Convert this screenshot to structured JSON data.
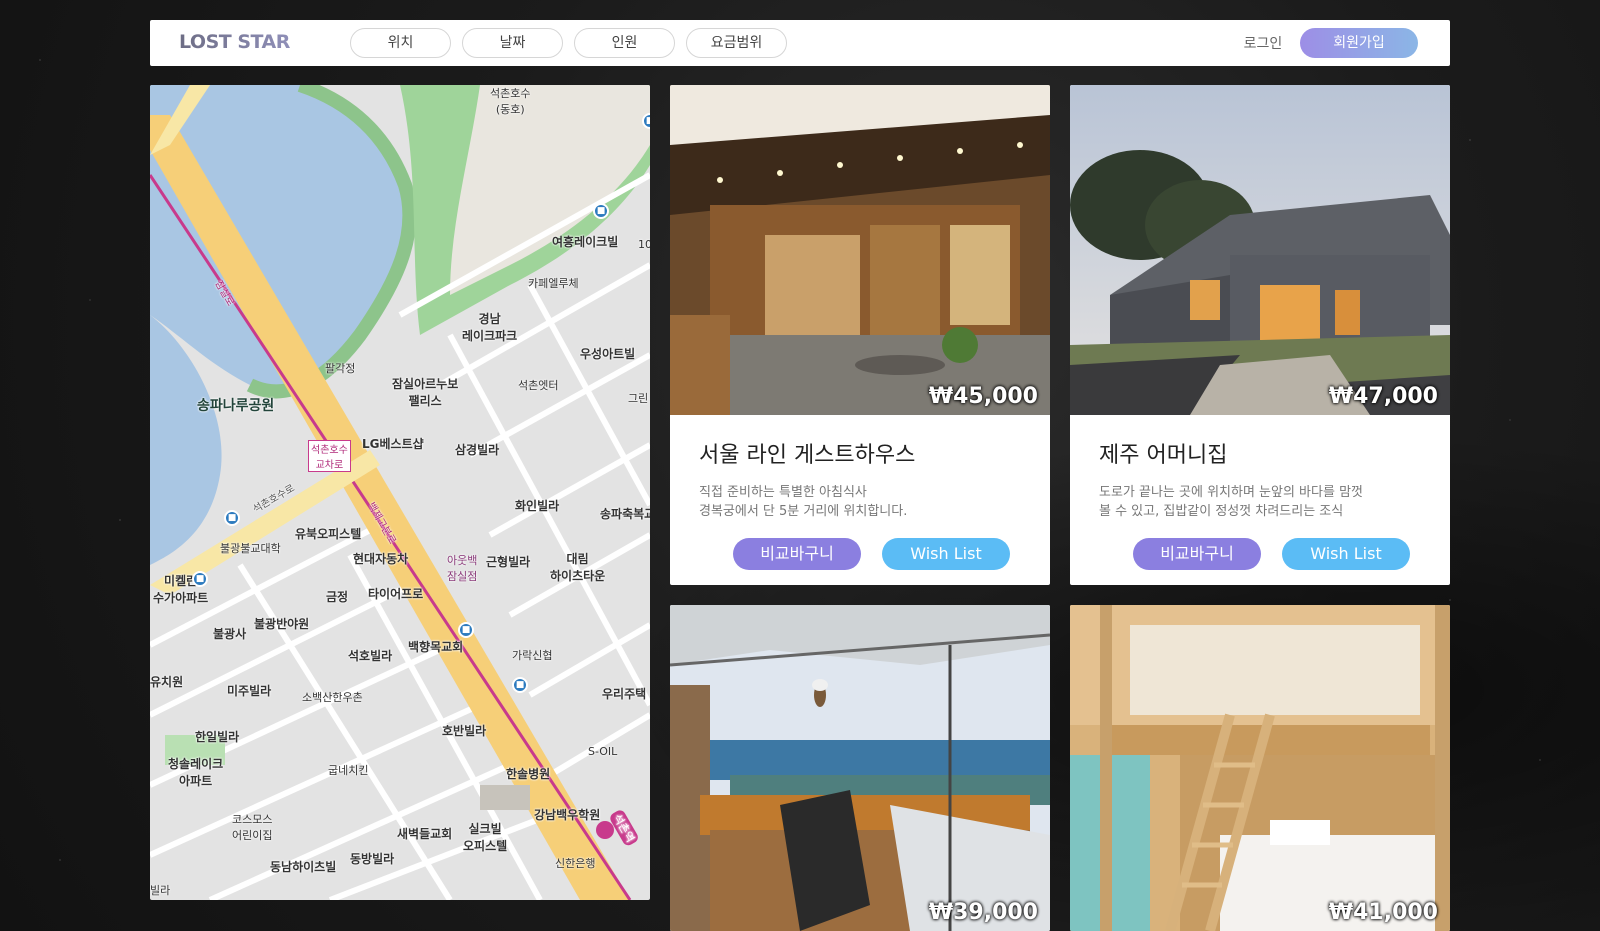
{
  "header": {
    "logo": "LOST STAR",
    "filters": [
      "위치",
      "날짜",
      "인원",
      "요금범위"
    ],
    "login_label": "로그인",
    "signup_label": "회원가입"
  },
  "map": {
    "labels": {
      "lake": "석촌호수\n(동호)",
      "yeoheung": "여흥레이크빌",
      "cafe": "카페엘루체",
      "gyeongnam": "경남\n레이크파크",
      "useong": "우성아트빌",
      "palgak": "팔각정",
      "park": "송파나루공원",
      "jamsil_arte": "잠실아르누보\n팰리스",
      "seokchon_etter": "석촌엣터",
      "lg": "LG베스트샵",
      "samgyeong": "삼경빌라",
      "seokchon_int": "석촌호수\n교차로",
      "hwain": "화인빌라",
      "songpa_chuk": "송파축복교",
      "yubuk": "유북오피스텔",
      "bulgwang_edu": "불광불교대학",
      "hyundai": "현대자동차",
      "geunhyeong": "근형빌라",
      "daerim": "대림\n하이츠타운",
      "michelan": "미켈란\n수가아파트",
      "outback": "아웃백\n잠실점",
      "tire": "타이어프로",
      "geumjeong": "금정",
      "bulgwangsa": "불광사",
      "bulgwangbanya": "불광반야원",
      "baekyang": "백향목교회",
      "garak": "가락신협",
      "seokho": "석호빌라",
      "uri": "우리주택",
      "mizu": "미주빌라",
      "sobaek": "소백산한우촌",
      "yuchi": "유치원",
      "hanil": "한일빌라",
      "hoban": "호반빌라",
      "soil": "S-OIL",
      "cheongsol": "청솔레이크\n아파트",
      "gubne": "굽네치킨",
      "hansol": "한솔병원",
      "gangnam_baek": "강남백우학원",
      "cosmos": "코스모스\n어린이집",
      "saebyeok": "새벽들교회",
      "silkeu": "실크빌\n오피스텔",
      "dongbang": "동방빌라",
      "dongnam": "동남하이츠빌",
      "shinhan": "신한은행",
      "seokchon_st": "석촌역",
      "road1": "잠실로",
      "road2": "백제고분로",
      "road3": "석촌호수로",
      "villa_edge": "빌라",
      "gran": "그린",
      "num10": "10"
    }
  },
  "listings": [
    {
      "price": "₩45,000",
      "title": "서울 라인 게스트하우스",
      "desc": "직접 준비하는 특별한 아침식사\n경복궁에서 단 5분 거리에 위치합니다.",
      "cart_label": "비교바구니",
      "wish_label": "Wish List"
    },
    {
      "price": "₩47,000",
      "title": "제주 어머니집",
      "desc": "도로가 끝나는 곳에 위치하며 눈앞의 바다를 맘껏\n볼 수 있고, 집밥같이 정성껏 차려드리는 조식",
      "cart_label": "비교바구니",
      "wish_label": "Wish List"
    },
    {
      "price": "₩39,000"
    },
    {
      "price": "₩41,000"
    }
  ]
}
